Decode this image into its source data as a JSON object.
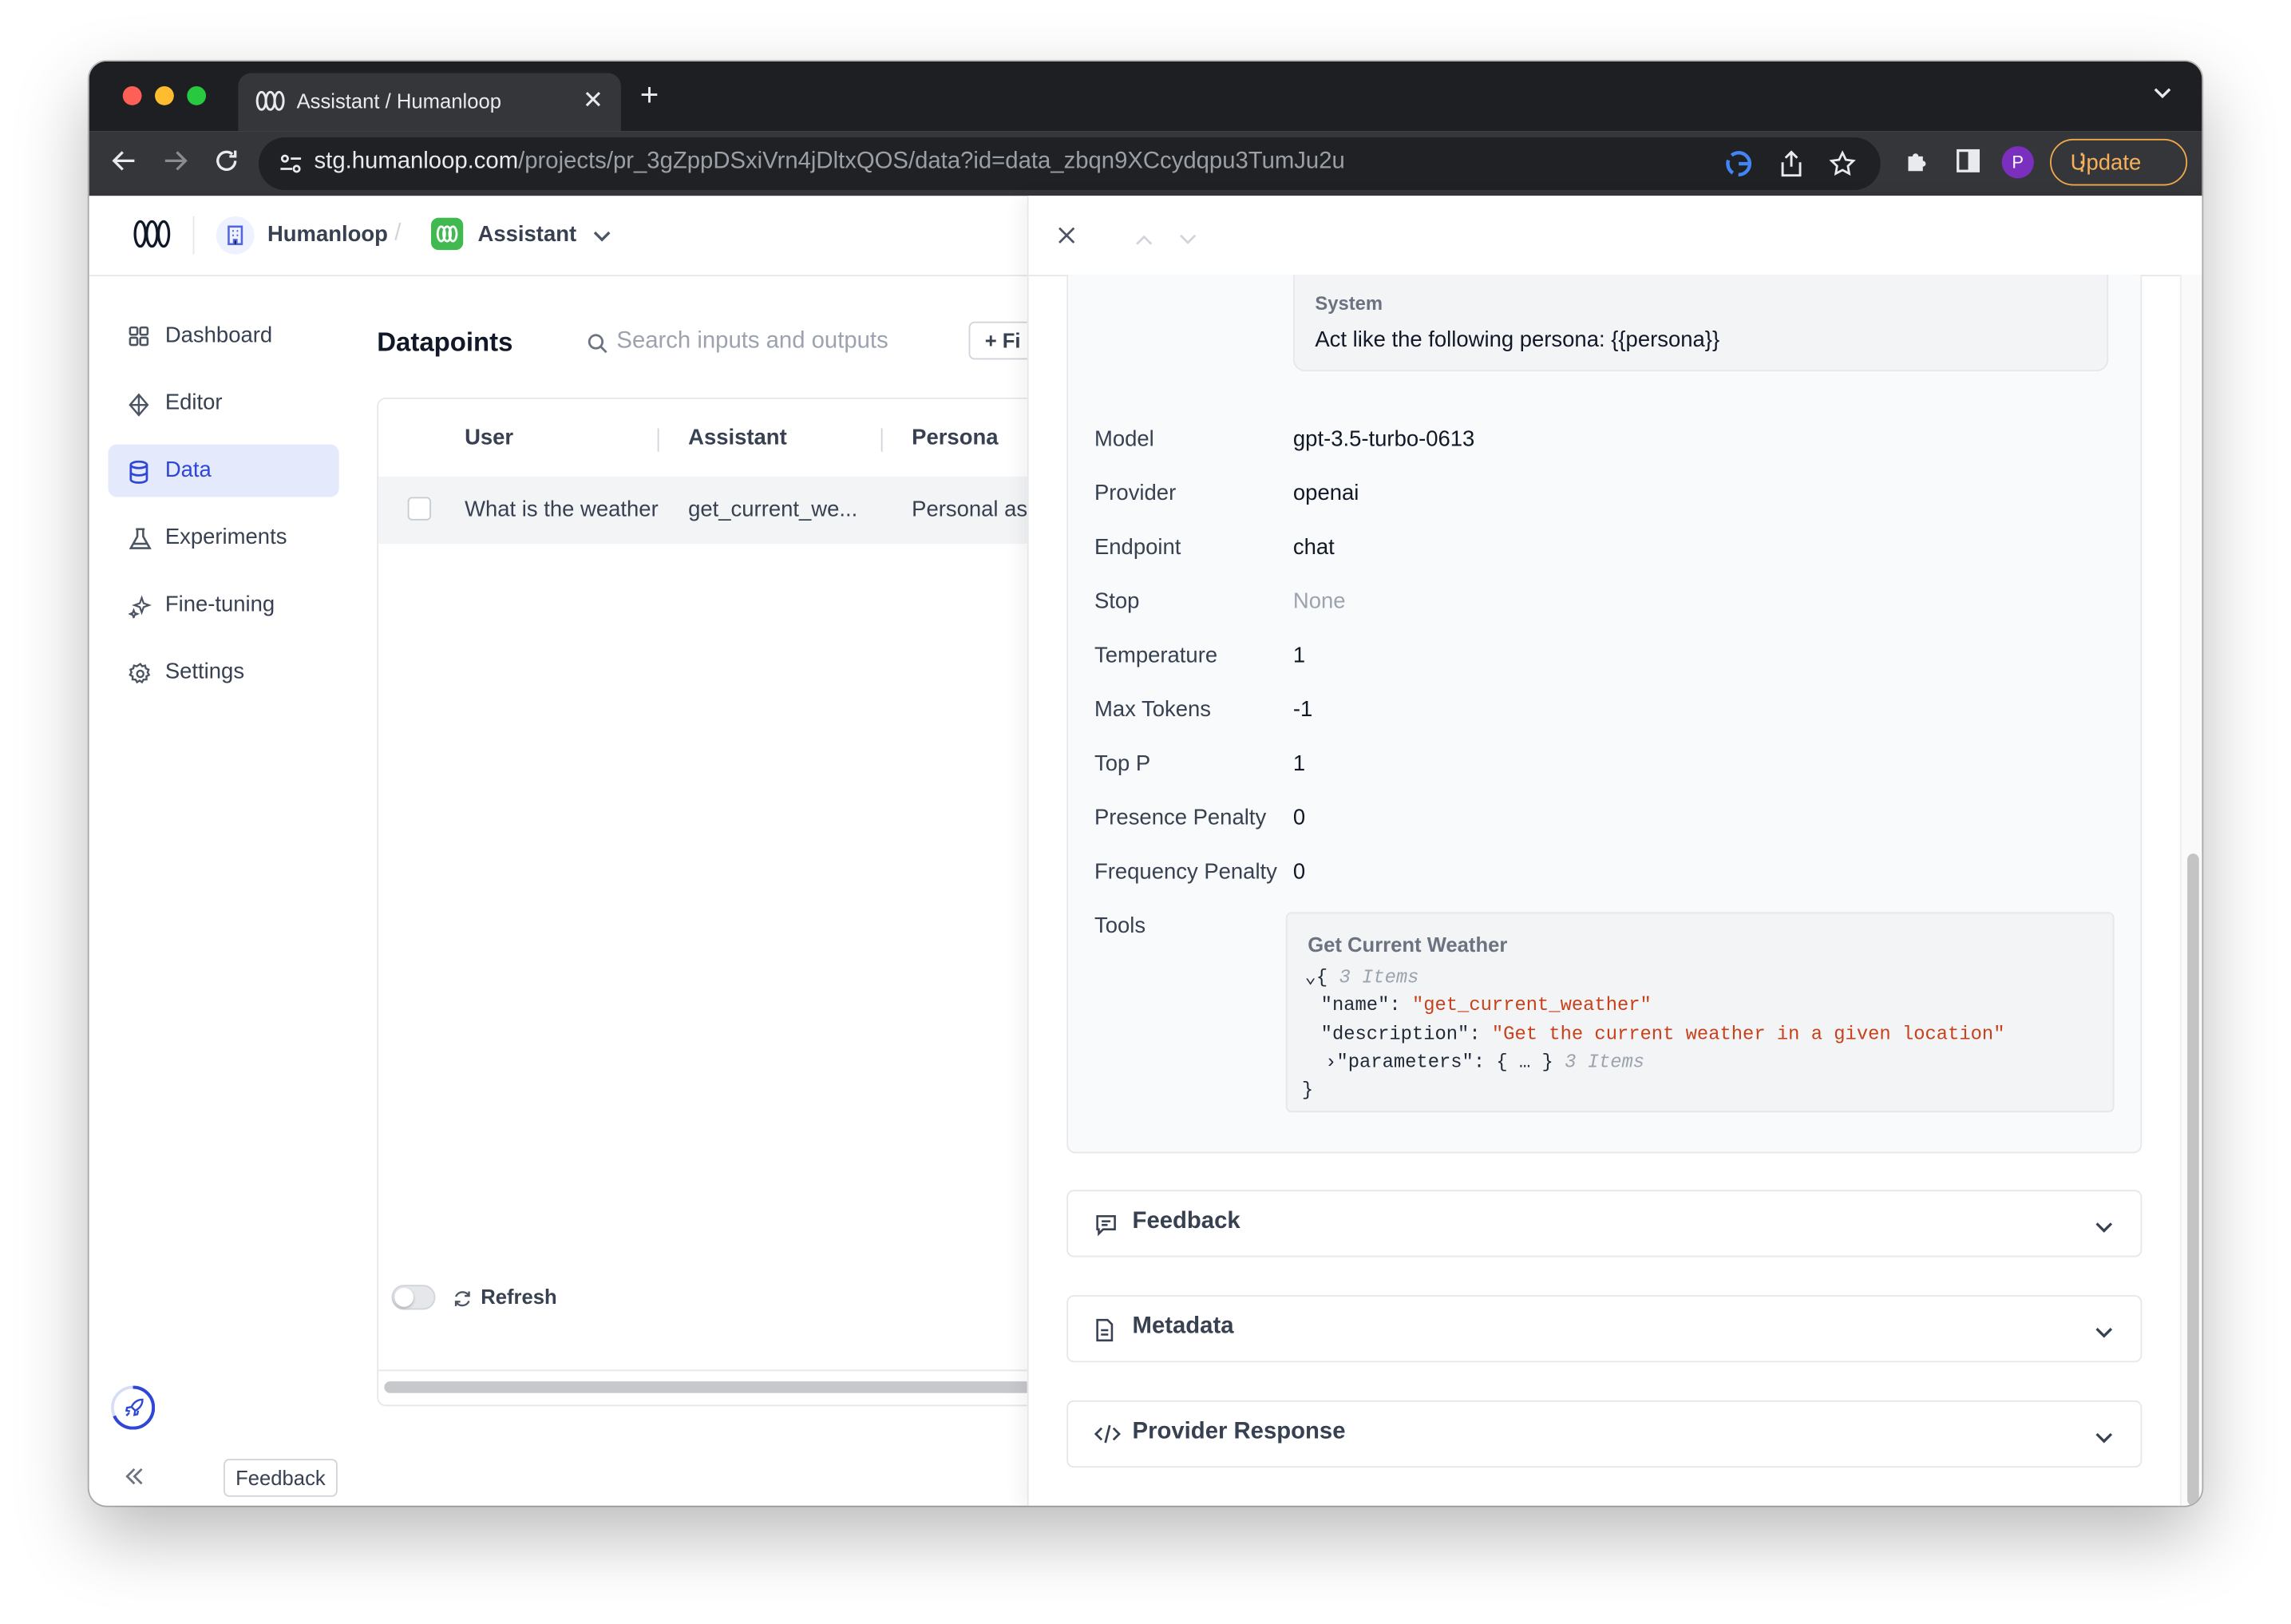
{
  "browser": {
    "tab_title": "Assistant / Humanloop",
    "url_host": "stg.humanloop.com",
    "url_path": "/projects/pr_3gZppDSxiVrn4jDltxQOS/data?id=data_zbqn9XCcydqpu3TumJu2u",
    "profile_initial": "P",
    "update_label": "Update"
  },
  "header": {
    "org_name": "Humanloop",
    "separator": "/",
    "project_name": "Assistant"
  },
  "sidebar": {
    "items": [
      {
        "label": "Dashboard",
        "icon": "grid-icon",
        "active": false
      },
      {
        "label": "Editor",
        "icon": "diamond-icon",
        "active": false
      },
      {
        "label": "Data",
        "icon": "database-icon",
        "active": true
      },
      {
        "label": "Experiments",
        "icon": "flask-icon",
        "active": false
      },
      {
        "label": "Fine-tuning",
        "icon": "sparkle-icon",
        "active": false
      },
      {
        "label": "Settings",
        "icon": "gear-icon",
        "active": false
      }
    ],
    "feedback_label": "Feedback"
  },
  "main": {
    "title": "Datapoints",
    "search_placeholder": "Search inputs and outputs",
    "filter_label": "+ Fi",
    "columns": [
      "User",
      "Assistant",
      "Persona"
    ],
    "rows": [
      {
        "user": "What is the weather",
        "assistant": "get_current_we...",
        "persona": "Personal ass"
      }
    ],
    "refresh_label": "Refresh"
  },
  "drawer": {
    "system_label": "System",
    "system_text": "Act like the following persona: {{persona}}",
    "params": [
      {
        "key": "Model",
        "value": "gpt-3.5-turbo-0613",
        "muted": false
      },
      {
        "key": "Provider",
        "value": "openai",
        "muted": false
      },
      {
        "key": "Endpoint",
        "value": "chat",
        "muted": false
      },
      {
        "key": "Stop",
        "value": "None",
        "muted": true
      },
      {
        "key": "Temperature",
        "value": "1",
        "muted": false
      },
      {
        "key": "Max Tokens",
        "value": "-1",
        "muted": false
      },
      {
        "key": "Top P",
        "value": "1",
        "muted": false
      },
      {
        "key": "Presence Penalty",
        "value": "0",
        "muted": false
      },
      {
        "key": "Frequency Penalty",
        "value": "0",
        "muted": false
      }
    ],
    "tools_label": "Tools",
    "tool": {
      "title": "Get Current Weather",
      "items_count": "3 Items",
      "name_key": "\"name\"",
      "name_value": "\"get_current_weather\"",
      "description_key": "\"description\"",
      "description_value": "\"Get the current weather in a given location\"",
      "parameters_key": "\"parameters\"",
      "parameters_collapsed": "{ … }",
      "parameters_count": "3 Items"
    },
    "sections": [
      {
        "label": "Feedback",
        "icon": "message-icon"
      },
      {
        "label": "Metadata",
        "icon": "document-icon"
      },
      {
        "label": "Provider Response",
        "icon": "code-icon"
      }
    ]
  },
  "colors": {
    "accent": "#2f47d6",
    "active_bg": "#e4e9fc",
    "json_string": "#c8411a",
    "update_orange": "#f6b15a"
  }
}
